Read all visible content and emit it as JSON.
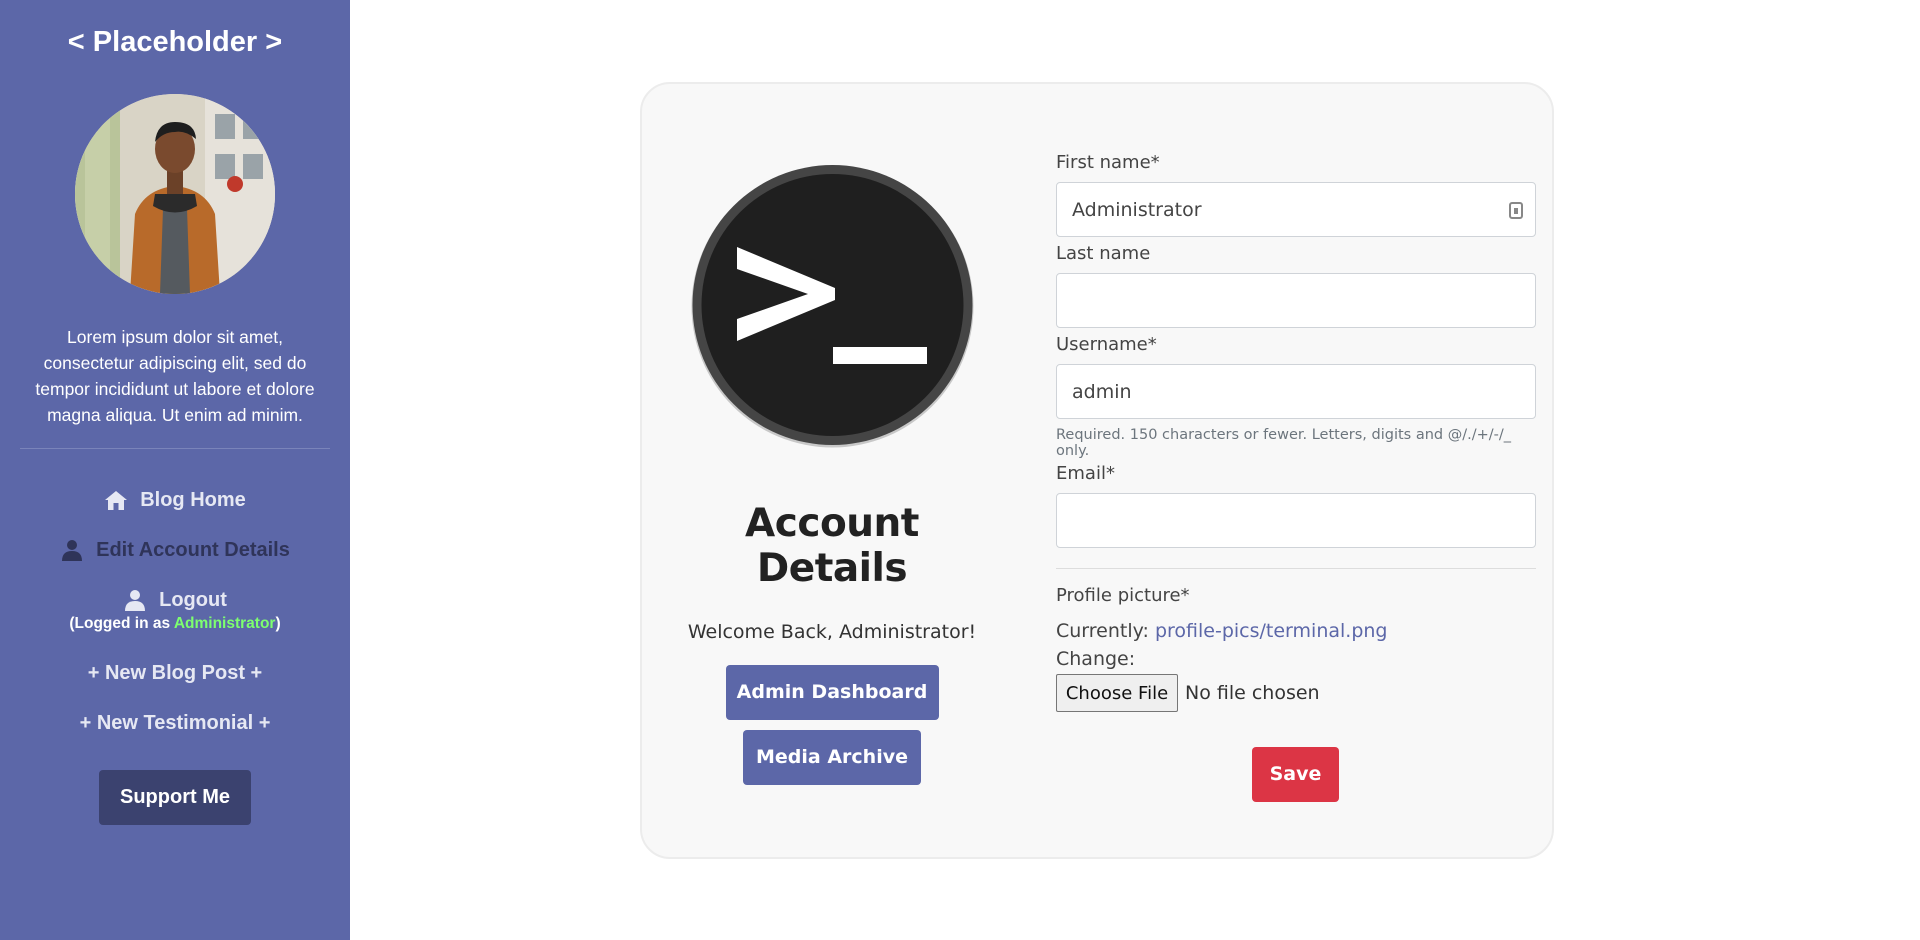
{
  "sidebar": {
    "brand": "< Placeholder >",
    "bio": "Lorem ipsum dolor sit amet, consectetur adipiscing elit, sed do tempor incididunt ut labore et dolore magna aliqua. Ut enim ad minim.",
    "nav": {
      "blog_home": "Blog Home",
      "edit_account": "Edit Account Details",
      "logout": "Logout"
    },
    "logged_in_prefix": "(Logged in as ",
    "logged_in_user": "Administrator",
    "logged_in_suffix": ")",
    "new_blog_post": "+ New Blog Post +",
    "new_testimonial": "+ New Testimonial +",
    "support_button": "Support Me",
    "colors": {
      "background": "#5c67a8",
      "active_item": "#2f3459",
      "username": "#7dff6f",
      "support_button": "#3b426f"
    }
  },
  "account": {
    "title": "Account Details",
    "welcome": "Welcome Back, Administrator!",
    "admin_dashboard": "Admin Dashboard",
    "media_archive": "Media Archive"
  },
  "form": {
    "first_name_label": "First name*",
    "first_name_value": "Administrator",
    "last_name_label": "Last name",
    "last_name_value": "",
    "username_label": "Username*",
    "username_value": "admin",
    "username_help": "Required. 150 characters or fewer. Letters, digits and @/./+/-/_ only.",
    "email_label": "Email*",
    "email_value": "",
    "profile_picture_label": "Profile picture*",
    "currently_label": "Currently: ",
    "currently_value": "profile-pics/terminal.png",
    "change_label": "Change:",
    "choose_file": "Choose File",
    "no_file": "No file chosen",
    "save_button": "Save",
    "colors": {
      "save": "#dc3545",
      "link": "#5c67a8"
    }
  }
}
